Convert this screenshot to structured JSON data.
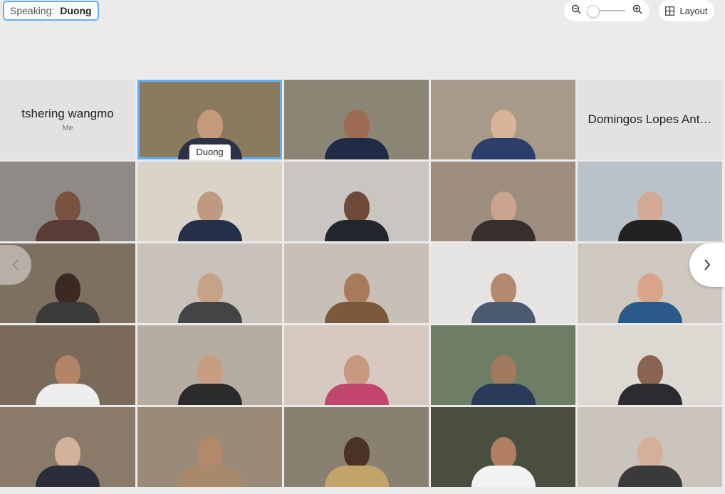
{
  "speaking": {
    "label": "Speaking:",
    "name": "Duong"
  },
  "zoom": {
    "out_icon": "zoom-out-icon",
    "in_icon": "zoom-in-icon",
    "level": 0.0
  },
  "layout_button": {
    "label": "Layout",
    "icon": "grid-icon"
  },
  "accent_color": "#5db0ff",
  "tiles": [
    {
      "type": "text",
      "name": "tshering wangmo",
      "sub": "Me"
    },
    {
      "type": "video",
      "name_tag": "Duong",
      "active": true,
      "bg": "#8a7a5e",
      "shirt": "#2b3245",
      "skin": "#c49a7a"
    },
    {
      "type": "video",
      "bg": "#8b8575",
      "shirt": "#1f2a44",
      "skin": "#9c6b52"
    },
    {
      "type": "video",
      "bg": "#a89a88",
      "shirt": "#2c3e6b",
      "skin": "#d7b49a"
    },
    {
      "type": "text",
      "name": "Domingos Lopes Ant…"
    },
    {
      "type": "video",
      "bg": "#8f8a86",
      "shirt": "#5a3b35",
      "skin": "#7a5240"
    },
    {
      "type": "video",
      "bg": "#d9d3c8",
      "shirt": "#24304a",
      "skin": "#c09a80"
    },
    {
      "type": "video",
      "bg": "#c9c6c2",
      "shirt": "#22252c",
      "skin": "#6e4a38"
    },
    {
      "type": "video",
      "bg": "#9e8e80",
      "shirt": "#3a2e2e",
      "skin": "#caa48c"
    },
    {
      "type": "video",
      "bg": "#b8c2c8",
      "shirt": "#222222",
      "skin": "#d2aa94"
    },
    {
      "type": "video",
      "bg": "#7e7060",
      "shirt": "#3d3a3a",
      "skin": "#3b2a22"
    },
    {
      "type": "video",
      "bg": "#c8c2ba",
      "shirt": "#444444",
      "skin": "#c6a286"
    },
    {
      "type": "video",
      "bg": "#c8bfb6",
      "shirt": "#7a5a3a",
      "skin": "#a87a5a"
    },
    {
      "type": "video",
      "bg": "#e6e4e2",
      "shirt": "#4b5a6e",
      "skin": "#b48a6e"
    },
    {
      "type": "video",
      "bg": "#cfc8be",
      "shirt": "#2a5a8a",
      "skin": "#d9a48a"
    },
    {
      "type": "video",
      "bg": "#7a6a5a",
      "shirt": "#eeeeee",
      "skin": "#b48466"
    },
    {
      "type": "video",
      "bg": "#b6ada0",
      "shirt": "#2b2b2b",
      "skin": "#c79e82"
    },
    {
      "type": "video",
      "bg": "#d7c9c0",
      "shirt": "#c2456e",
      "skin": "#c89880"
    },
    {
      "type": "video",
      "bg": "#6e7e64",
      "shirt": "#2c3a5a",
      "skin": "#a27a5e"
    },
    {
      "type": "video",
      "bg": "#dcd8d2",
      "shirt": "#2b2b30",
      "skin": "#8a6450"
    },
    {
      "type": "video",
      "bg": "#8a7a6a",
      "shirt": "#2a2e3a",
      "skin": "#d2b29a"
    },
    {
      "type": "video",
      "bg": "#9a8a78",
      "shirt": "#a88a6a",
      "skin": "#b4886a"
    },
    {
      "type": "video",
      "bg": "#8a8072",
      "shirt": "#c2a46a",
      "skin": "#4a3228"
    },
    {
      "type": "video",
      "bg": "#4a4e3e",
      "shirt": "#f2f2f2",
      "skin": "#b07e62"
    },
    {
      "type": "video",
      "bg": "#cac4bc",
      "shirt": "#3a3a3a",
      "skin": "#d4b09a"
    }
  ],
  "nav": {
    "prev_icon": "chevron-left-icon",
    "next_icon": "chevron-right-icon"
  }
}
